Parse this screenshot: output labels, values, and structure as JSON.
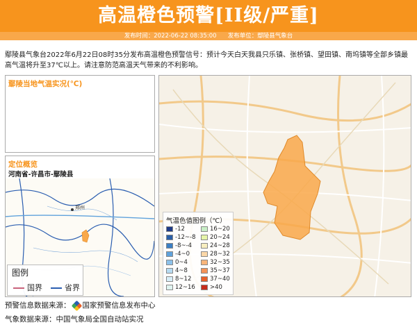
{
  "header": {
    "title": "高温橙色预警[II级/严重]",
    "publish_time_label": "发布时间：2022-06-22 08:35:00",
    "publisher_label": "发布单位：鄢陵县气象台",
    "accent_color": "#f7941d"
  },
  "body_text": "鄢陵县气象台2022年6月22日08时35分发布高温橙色预警信号：预计今天白天我县只乐镇、张桥镇、望田镇、南坞镇等全部乡镇最高气温将升至37℃以上。请注意防范高温天气带来的不利影响。",
  "temp_panel": {
    "title": "鄢陵当地气温实况(℃)"
  },
  "location_panel": {
    "title": "定位概览",
    "path": "河南省-许昌市-鄢陵县",
    "city_label": "郑州",
    "legend_title": "图例",
    "legend_items": [
      {
        "label": "国界",
        "color": "#c9627b"
      },
      {
        "label": "省界",
        "color": "#2a5db0"
      }
    ]
  },
  "map_legend": {
    "title": "气温色值图例（℃）",
    "items": [
      {
        "label": "-12",
        "color": "#1f3c88"
      },
      {
        "label": "-12~-8",
        "color": "#2a5fa8"
      },
      {
        "label": "-8~-4",
        "color": "#3b7fc4"
      },
      {
        "label": "-4~0",
        "color": "#5fa2dc"
      },
      {
        "label": "0~4",
        "color": "#8cc1ea"
      },
      {
        "label": "4~8",
        "color": "#b7dbf2"
      },
      {
        "label": "8~12",
        "color": "#d8eef8"
      },
      {
        "label": "12~16",
        "color": "#dff3f0"
      },
      {
        "label": "16~20",
        "color": "#c9efc7"
      },
      {
        "label": "20~24",
        "color": "#e6f5a8"
      },
      {
        "label": "24~28",
        "color": "#f8eec0"
      },
      {
        "label": "28~32",
        "color": "#fbd7a8"
      },
      {
        "label": "32~35",
        "color": "#f9b57a"
      },
      {
        "label": "35~37",
        "color": "#f59358"
      },
      {
        "label": "37~40",
        "color": "#e8602a"
      },
      {
        "label": ">40",
        "color": "#c72c1b"
      }
    ]
  },
  "footer": {
    "warning_source_label": "预警信息数据来源：",
    "warning_source": "国家预警信息发布中心",
    "weather_source": "气象数据来源：中国气象局全国自动站实况"
  },
  "chart_data": {
    "type": "heatmap",
    "title": "鄢陵当地气温实况(℃)",
    "legend_title": "气温色值图例（℃）",
    "legend_bins": [
      "-12",
      "-12~-8",
      "-8~-4",
      "-4~0",
      "0~4",
      "4~8",
      "8~12",
      "12~16",
      "16~20",
      "20~24",
      "24~28",
      "28~32",
      "32~35",
      "35~37",
      "37~40",
      ">40"
    ],
    "region": "河南省-许昌市-鄢陵县",
    "highlighted_bin": "35~37"
  }
}
